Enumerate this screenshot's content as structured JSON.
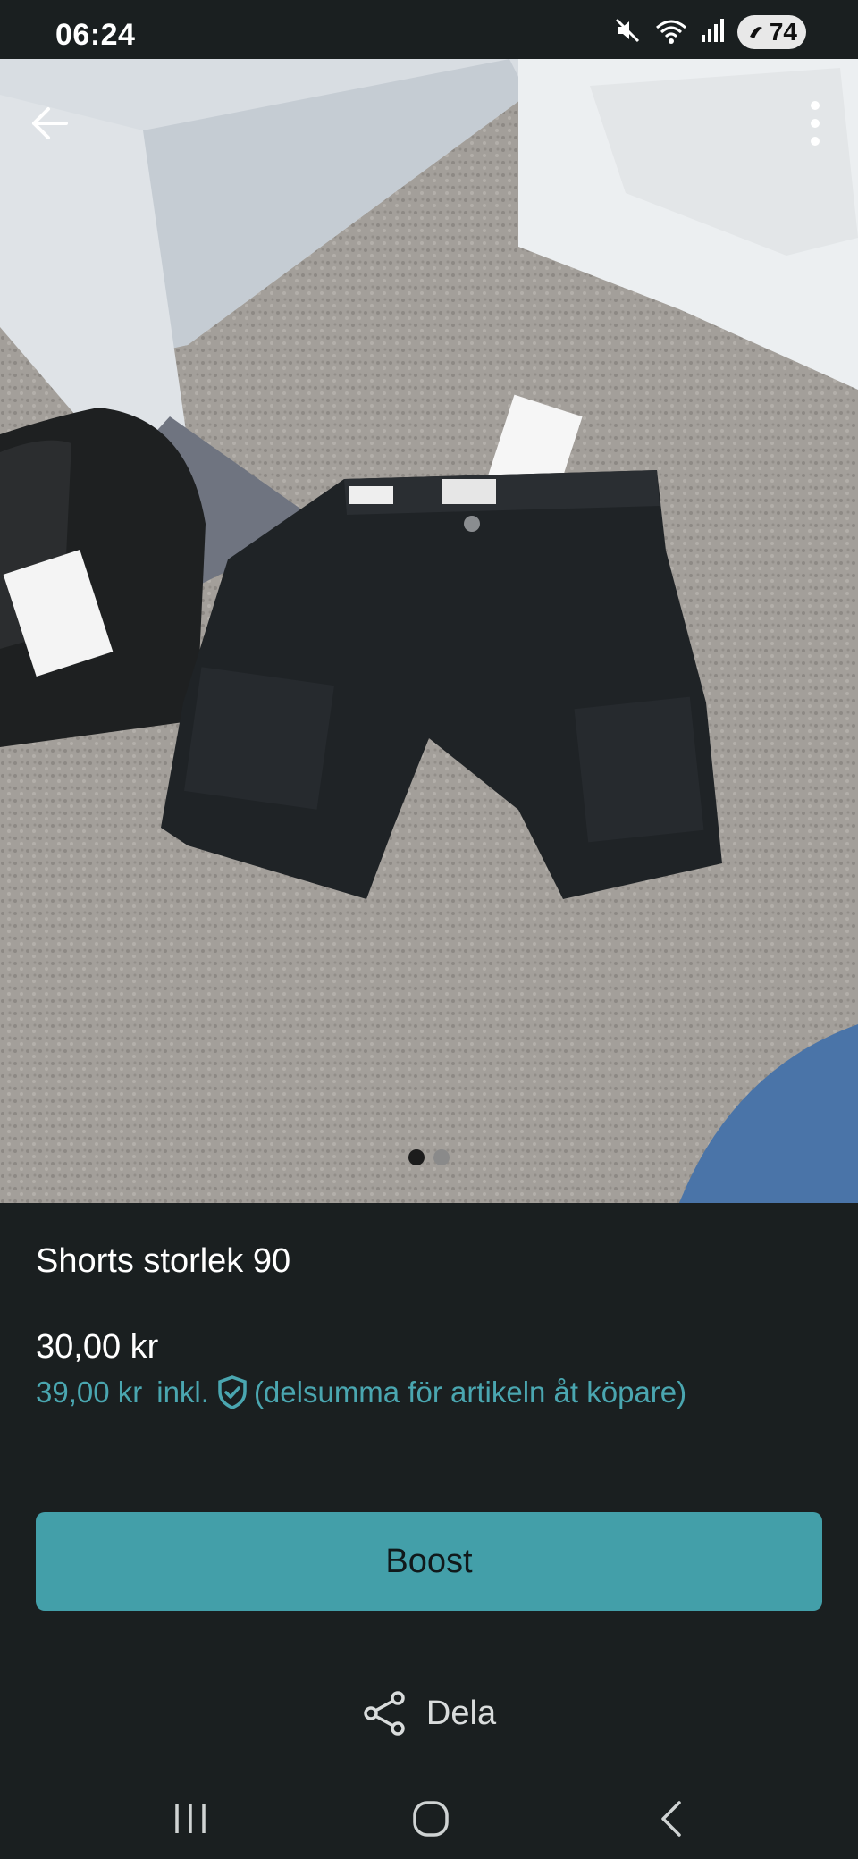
{
  "status_bar": {
    "time": "06:24",
    "battery": "74",
    "icons": [
      "mute-icon",
      "wifi-icon",
      "signal-icon",
      "battery-icon"
    ]
  },
  "gallery": {
    "image_count": 2,
    "current_index": 1,
    "image_alt": "black cargo shorts"
  },
  "listing": {
    "title": "Shorts storlek 90",
    "price": "30,00 kr",
    "price_incl_amount": "39,00 kr",
    "price_incl_word": "inkl.",
    "price_incl_note": "(delsumma för artikeln åt köpare)"
  },
  "actions": {
    "boost_label": "Boost",
    "share_label": "Dela"
  },
  "colors": {
    "background": "#1a1f20",
    "accent": "#439fa9",
    "accent_text": "#4aa6b0"
  }
}
